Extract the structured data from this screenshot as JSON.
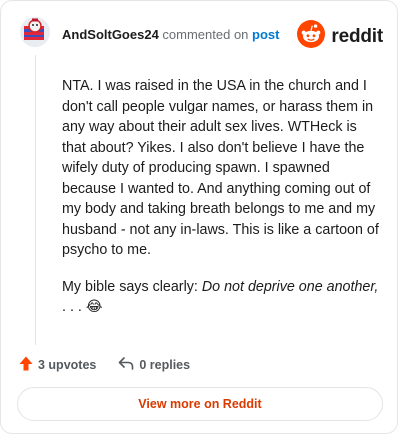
{
  "header": {
    "username": "AndSoltGoes24",
    "commented_text": "commented on",
    "post_link": "post"
  },
  "brand": {
    "logo_text": "reddit",
    "icon": "reddit-snoo-icon",
    "color": "#ff4500"
  },
  "comment": {
    "paragraph1": "NTA. I was raised in the USA in the church and I don't call people vulgar names, or harass them in any way about their adult sex lives. WTHeck is that about? Yikes. I also don't believe I have the wifely duty of producing spawn. I spawned because I wanted to. And anything coming out of my body and taking breath belongs to me and my husband - not any in-laws. This is like a cartoon of psycho to me.",
    "paragraph2_prefix": "My bible says clearly: ",
    "paragraph2_italic": "Do not deprive one another,",
    "paragraph2_suffix": " . . . 😂"
  },
  "actions": {
    "upvotes": "3 upvotes",
    "replies": "0 replies",
    "upvote_icon": "upvote-arrow-icon",
    "reply_icon": "reply-arrow-icon",
    "upvote_color": "#ff4500"
  },
  "view_more": {
    "label": "View more on Reddit",
    "color": "#d93a00"
  }
}
